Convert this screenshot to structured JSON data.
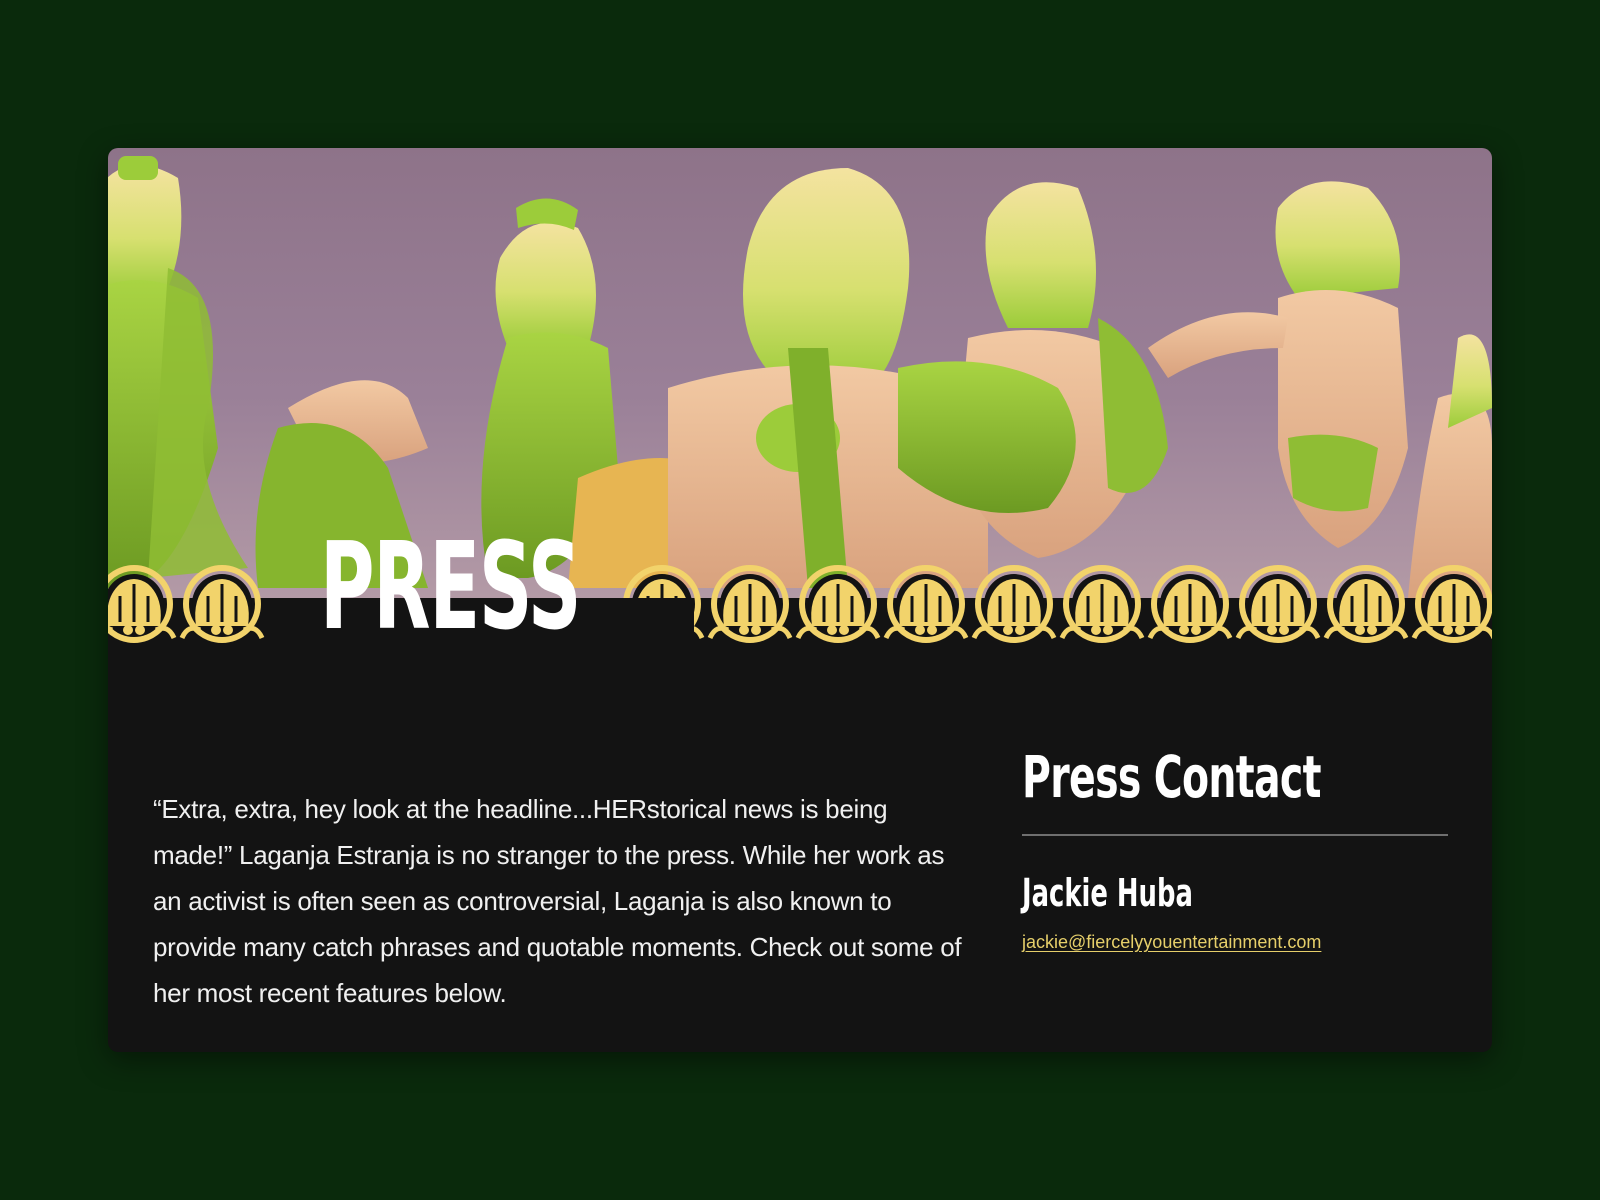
{
  "hero": {
    "title": "PRESS"
  },
  "intro": {
    "text": "“Extra, extra, hey look at the headline...HERstorical news is being made!” Laganja Estranja is no stranger to the press. While her work as an activist is often seen as controversial, Laganja is also known to provide many catch phrases and quotable moments. Check out some of her most recent features below."
  },
  "contact": {
    "heading": "Press Contact",
    "name": "Jackie Huba",
    "email": "jackie@fiercelyyouentertainment.com"
  },
  "colors": {
    "page_background": "#0a2a0c",
    "card_background": "#131313",
    "ornament_gold": "#f2d36b",
    "link_color": "#e6cf6a",
    "hero_sky": "#8e7389"
  },
  "icons": {
    "ornament": "palmette-ornament"
  }
}
